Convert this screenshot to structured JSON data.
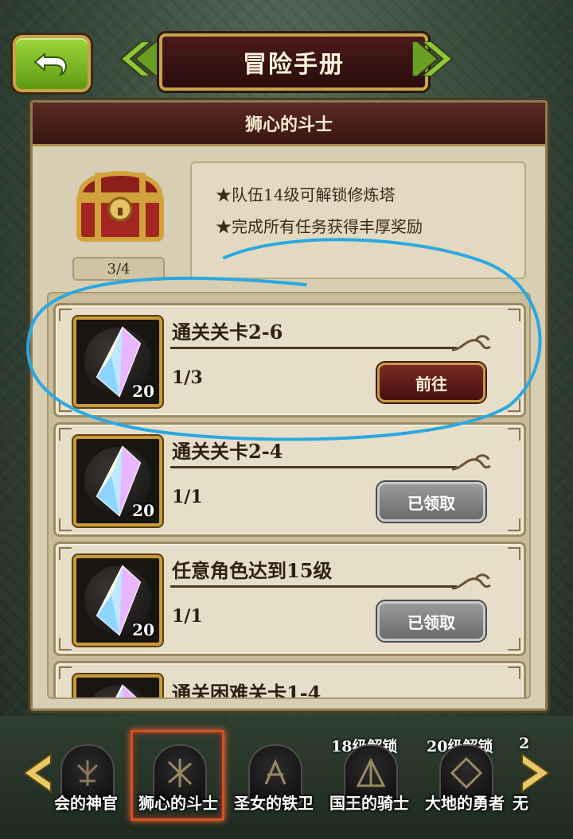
{
  "header": {
    "title": "冒险手册",
    "back_icon": "return-arrow-icon"
  },
  "panel": {
    "title": "狮心的斗士",
    "chest_progress": "3/4",
    "info_lines": [
      "★队伍14级可解锁修炼塔",
      "★完成所有任务获得丰厚奖励"
    ]
  },
  "quests": [
    {
      "title": "通关关卡2-6",
      "progress": "1/3",
      "reward_count": "20",
      "button": "前往",
      "state": "go"
    },
    {
      "title": "通关关卡2-4",
      "progress": "1/1",
      "reward_count": "20",
      "button": "已领取",
      "state": "done"
    },
    {
      "title": "任意角色达到15级",
      "progress": "1/1",
      "reward_count": "20",
      "button": "已领取",
      "state": "done"
    },
    {
      "title": "通关困难关卡1-4",
      "progress": "",
      "reward_count": "",
      "button": "",
      "state": "partial"
    }
  ],
  "tabs": [
    {
      "name": "会的神官",
      "icon": "rune-icon"
    },
    {
      "name": "狮心的斗士",
      "icon": "star-slash-icon",
      "selected": true
    },
    {
      "name": "圣女的铁卫",
      "icon": "rune-x-icon"
    },
    {
      "name": "国王的骑士",
      "icon": "triangle-rune-icon",
      "unlock": "18级解锁"
    },
    {
      "name": "大地的勇者",
      "icon": "diamond-rune-icon",
      "unlock": "20级解锁"
    },
    {
      "name": "无",
      "unlock": "2"
    }
  ],
  "colors": {
    "accent_gold": "#c9a24c",
    "go_button": "#7a2a24",
    "done_button": "#8a8a8c",
    "annotation_stroke": "#2aa8e0"
  }
}
